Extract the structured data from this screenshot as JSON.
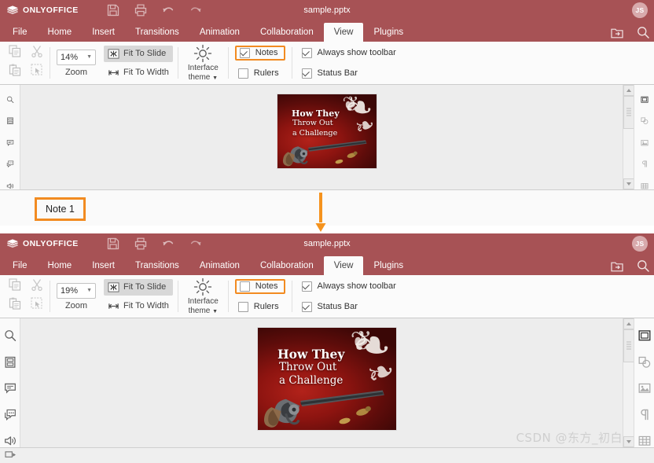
{
  "app": {
    "brand": "ONLYOFFICE",
    "logo_icon": "layers-icon",
    "avatar_initials": "JS"
  },
  "windows": [
    {
      "id": "before",
      "titlebar": {
        "doc_title": "sample.pptx",
        "quick_access": [
          {
            "name": "save-icon",
            "label": "Save"
          },
          {
            "name": "print-icon",
            "label": "Print"
          },
          {
            "name": "undo-icon",
            "label": "Undo"
          },
          {
            "name": "redo-icon",
            "label": "Redo"
          }
        ]
      },
      "tabs": [
        {
          "label": "File",
          "active": false
        },
        {
          "label": "Home",
          "active": false
        },
        {
          "label": "Insert",
          "active": false
        },
        {
          "label": "Transitions",
          "active": false
        },
        {
          "label": "Animation",
          "active": false
        },
        {
          "label": "Collaboration",
          "active": false
        },
        {
          "label": "View",
          "active": true
        },
        {
          "label": "Plugins",
          "active": false
        }
      ],
      "tab_actions": [
        {
          "name": "open-file-location-icon"
        },
        {
          "name": "search-icon"
        }
      ],
      "ribbon": {
        "clipboard": [
          {
            "name": "copy-icon"
          },
          {
            "name": "cut-icon"
          },
          {
            "name": "paste-icon"
          },
          {
            "name": "select-all-icon"
          }
        ],
        "zoom_value": "14%",
        "zoom_label": "Zoom",
        "fit_to_slide": "Fit To Slide",
        "fit_to_slide_selected": true,
        "fit_to_width": "Fit To Width",
        "interface_theme_line1": "Interface",
        "interface_theme_line2": "theme",
        "checkboxes": [
          {
            "label": "Notes",
            "checked": true,
            "highlighted": true
          },
          {
            "label": "Rulers",
            "checked": false,
            "highlighted": false
          },
          {
            "label": "Always show toolbar",
            "checked": true,
            "highlighted": false
          },
          {
            "label": "Status Bar",
            "checked": true,
            "highlighted": false
          }
        ]
      },
      "left_sidebar": [
        {
          "name": "search-icon"
        },
        {
          "name": "slides-icon"
        },
        {
          "name": "comments-icon"
        },
        {
          "name": "chat-icon"
        },
        {
          "name": "feedback-icon"
        }
      ],
      "right_sidebar": [
        {
          "name": "slide-settings-icon",
          "active": true
        },
        {
          "name": "shape-settings-icon",
          "active": false
        },
        {
          "name": "image-settings-icon",
          "active": false
        },
        {
          "name": "paragraph-settings-icon",
          "active": false
        },
        {
          "name": "table-settings-icon",
          "active": false
        }
      ],
      "slide": {
        "title_line1": "How They",
        "title_line2": "Throw Out",
        "title_line3": "a Challenge",
        "bg_color": "#8d1410"
      },
      "notes_pane_visible": true,
      "note_text": "Note 1",
      "note_highlighted": true
    },
    {
      "id": "after",
      "titlebar": {
        "doc_title": "sample.pptx",
        "quick_access": [
          {
            "name": "save-icon",
            "label": "Save"
          },
          {
            "name": "print-icon",
            "label": "Print"
          },
          {
            "name": "undo-icon",
            "label": "Undo"
          },
          {
            "name": "redo-icon",
            "label": "Redo"
          }
        ]
      },
      "tabs": [
        {
          "label": "File",
          "active": false
        },
        {
          "label": "Home",
          "active": false
        },
        {
          "label": "Insert",
          "active": false
        },
        {
          "label": "Transitions",
          "active": false
        },
        {
          "label": "Animation",
          "active": false
        },
        {
          "label": "Collaboration",
          "active": false
        },
        {
          "label": "View",
          "active": true
        },
        {
          "label": "Plugins",
          "active": false
        }
      ],
      "tab_actions": [
        {
          "name": "open-file-location-icon"
        },
        {
          "name": "search-icon"
        }
      ],
      "ribbon": {
        "clipboard": [
          {
            "name": "copy-icon"
          },
          {
            "name": "cut-icon"
          },
          {
            "name": "paste-icon"
          },
          {
            "name": "select-all-icon"
          }
        ],
        "zoom_value": "19%",
        "zoom_label": "Zoom",
        "fit_to_slide": "Fit To Slide",
        "fit_to_slide_selected": true,
        "fit_to_width": "Fit To Width",
        "interface_theme_line1": "Interface",
        "interface_theme_line2": "theme",
        "checkboxes": [
          {
            "label": "Notes",
            "checked": false,
            "highlighted": true
          },
          {
            "label": "Rulers",
            "checked": false,
            "highlighted": false
          },
          {
            "label": "Always show toolbar",
            "checked": true,
            "highlighted": false
          },
          {
            "label": "Status Bar",
            "checked": true,
            "highlighted": false
          }
        ]
      },
      "left_sidebar": [
        {
          "name": "search-icon"
        },
        {
          "name": "slides-icon"
        },
        {
          "name": "comments-icon"
        },
        {
          "name": "chat-icon"
        },
        {
          "name": "feedback-icon"
        }
      ],
      "right_sidebar": [
        {
          "name": "slide-settings-icon",
          "active": true
        },
        {
          "name": "shape-settings-icon",
          "active": false
        },
        {
          "name": "image-settings-icon",
          "active": false
        },
        {
          "name": "paragraph-settings-icon",
          "active": false
        },
        {
          "name": "table-settings-icon",
          "active": false
        }
      ],
      "slide": {
        "title_line1": "How They",
        "title_line2": "Throw Out",
        "title_line3": "a Challenge",
        "bg_color": "#8d1410"
      },
      "notes_pane_visible": false,
      "note_text": "",
      "note_highlighted": false
    }
  ],
  "annotation": {
    "arrow_icon": "down-arrow-icon",
    "arrow_color": "#f5931e",
    "highlight_color": "#f28b21"
  },
  "watermark": "CSDN @东方_初白",
  "theme": {
    "header_bg": "#a75255",
    "ribbon_bg": "#fbfbfb",
    "canvas_bg": "#ededed"
  }
}
